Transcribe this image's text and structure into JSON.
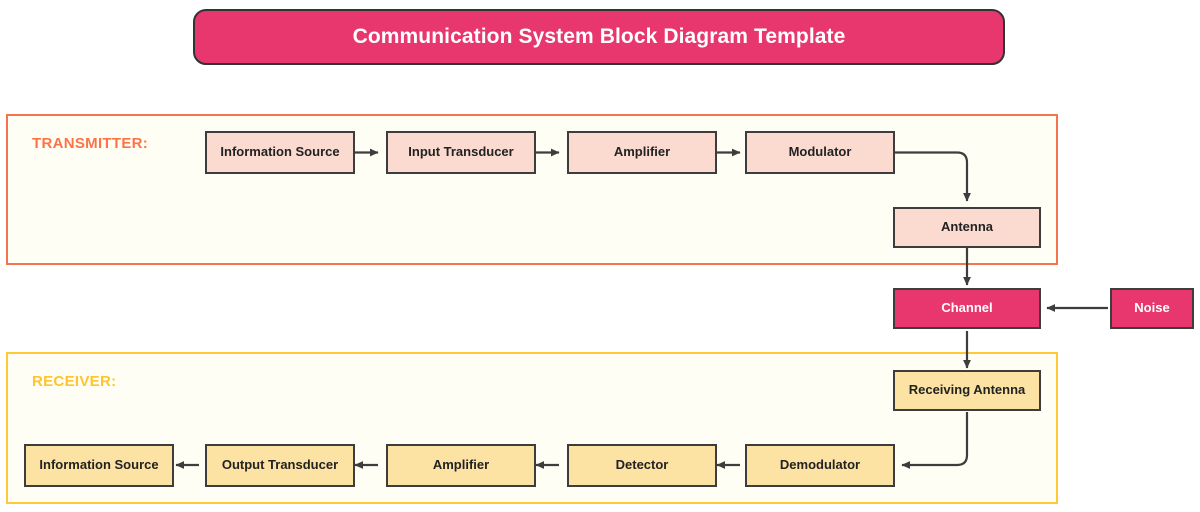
{
  "title": {
    "text": "Communication System Block Diagram Template",
    "bg_color": "#E8376F",
    "text_color": "#FFFFFF"
  },
  "sections": {
    "transmitter": {
      "label": "TRANSMITTER:",
      "border_color": "#F4744B",
      "label_color": "#FC7348",
      "fill_color": "#FFFEF4"
    },
    "receiver": {
      "label": "RECEIVER:",
      "border_color": "#FFC835",
      "label_color": "#FFC42E",
      "fill_color": "#FFFEF4"
    }
  },
  "palette": {
    "transmitter_node_fill": "#FBDAD0",
    "receiver_node_fill": "#FCE3A4",
    "channel_node_fill": "#E8376F",
    "node_border": "#3D3D3D",
    "connector": "#3D3D3D"
  },
  "nodes": {
    "tx_information_source": "Information Source",
    "tx_input_transducer": "Input Transducer",
    "tx_amplifier": "Amplifier",
    "tx_modulator": "Modulator",
    "tx_antenna": "Antenna",
    "channel": "Channel",
    "noise": "Noise",
    "rx_receiving_antenna": "Receiving Antenna",
    "rx_demodulator": "Demodulator",
    "rx_detector": "Detector",
    "rx_amplifier": "Amplifier",
    "rx_output_transducer": "Output Transducer",
    "rx_information_source": "Information Source"
  },
  "flow": {
    "transmitter_chain": [
      "Information Source",
      "Input Transducer",
      "Amplifier",
      "Modulator",
      "Antenna"
    ],
    "channel_chain": [
      "Antenna",
      "Channel",
      "Receiving Antenna"
    ],
    "noise_injection": [
      "Noise",
      "Channel"
    ],
    "receiver_chain": [
      "Receiving Antenna",
      "Demodulator",
      "Detector",
      "Amplifier",
      "Output Transducer",
      "Information Source"
    ]
  }
}
